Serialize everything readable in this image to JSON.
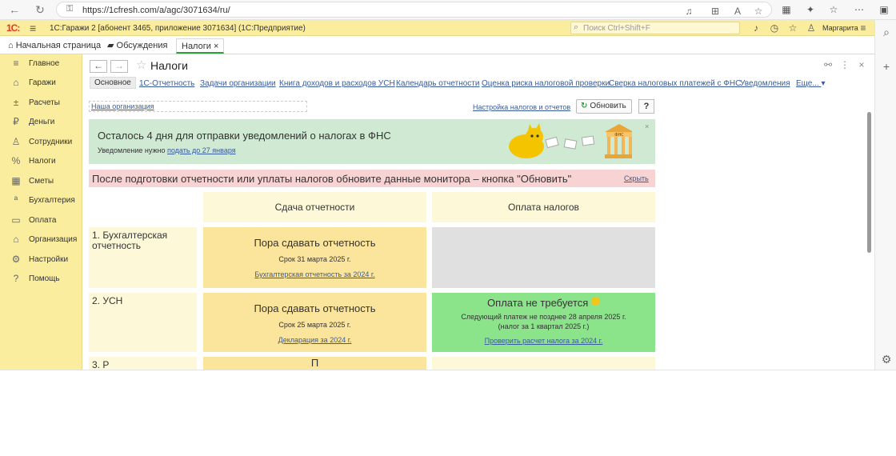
{
  "browser": {
    "url": "https://1cfresh.com/a/agc/3071634/ru/",
    "back_icon": "arrow-left-icon",
    "refresh_icon": "refresh-icon"
  },
  "app": {
    "logo": "1С:",
    "title": "1С:Гаражи 2 [абонент 3465, приложение 3071634]  (1С:Предприятие)",
    "search_placeholder": "Поиск Ctrl+Shift+F",
    "user": "Маргарита"
  },
  "tabs": [
    {
      "label": "Начальная страница"
    },
    {
      "label": "Обсуждения"
    },
    {
      "label": "Налоги"
    }
  ],
  "tab_close": "×",
  "sidebar": {
    "items": [
      {
        "label": "Главное",
        "icon": "≡"
      },
      {
        "label": "Гаражи",
        "icon": "⌂"
      },
      {
        "label": "Расчеты",
        "icon": "±"
      },
      {
        "label": "Деньги",
        "icon": "₽"
      },
      {
        "label": "Сотрудники",
        "icon": "♙"
      },
      {
        "label": "Налоги",
        "icon": "%"
      },
      {
        "label": "Сметы",
        "icon": "▦"
      },
      {
        "label": "Бухгалтерия",
        "icon": "ª"
      },
      {
        "label": "Оплата",
        "icon": "▭"
      },
      {
        "label": "Организация",
        "icon": "⌂"
      },
      {
        "label": "Настройки",
        "icon": "⚙"
      },
      {
        "label": "Помощь",
        "icon": "?"
      }
    ]
  },
  "page": {
    "title": "Налоги",
    "subtabs": [
      "Основное",
      "1С-Отчетность",
      "Задачи организации",
      "Книга доходов и расходов УСН",
      "Календарь отчетности",
      "Оценка риска налоговой проверки",
      "Сверка налоговых платежей с ФНС",
      "Уведомления",
      "Еще..."
    ],
    "org_field": "Наша организация",
    "settings_link": "Настройка налогов и отчетов",
    "refresh_label": "Обновить",
    "help_label": "?"
  },
  "notice": {
    "title": "Осталось 4 дня для отправки уведомлений о налогах в ФНС",
    "sub_prefix": "Уведомление нужно ",
    "sub_link": "подать до 27 января",
    "close": "×",
    "art_label": "ФНС"
  },
  "warning": {
    "text": "После подготовки отчетности или уплаты налогов обновите данные монитора – кнопка \"Обновить\"",
    "hide_link": "Скрыть"
  },
  "grid": {
    "col_reports": "Сдача отчетности",
    "col_payments": "Оплата налогов",
    "rows": [
      {
        "label": "1. Бухгалтерская отчетность",
        "report_title": "Пора сдавать отчетность",
        "report_deadline": "Срок 31 марта 2025 г.",
        "report_link": "Бухгалтерская отчетность за 2024 г."
      },
      {
        "label": "2. УСН",
        "report_title": "Пора сдавать отчетность",
        "report_deadline": "Срок 25 марта 2025 г.",
        "report_link": "Декларация за 2024 г.",
        "pay_title": "Оплата не требуется",
        "pay_line1": "Следующий платеж не позднее 28 апреля 2025 г.",
        "pay_line2": "(налог за 1 квартал 2025 г.)",
        "pay_link": "Проверить расчет налога за 2024 г."
      },
      {
        "label": "3. Р",
        "report_title": "П"
      }
    ]
  }
}
